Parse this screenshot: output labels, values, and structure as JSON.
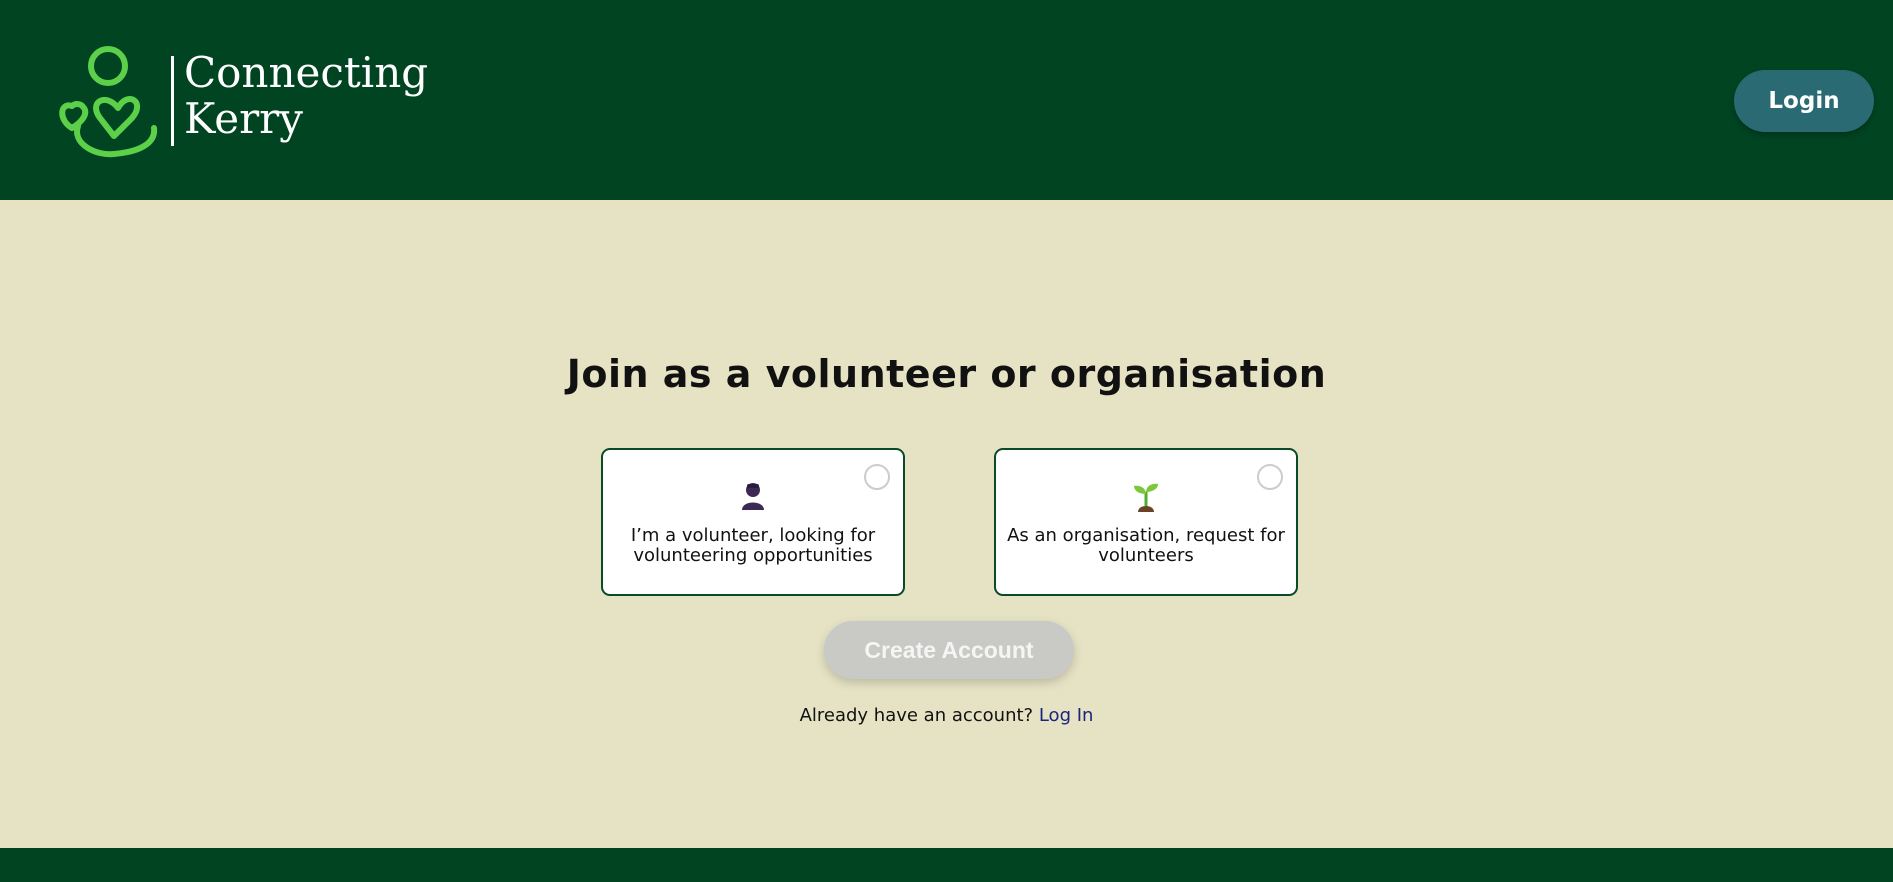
{
  "header": {
    "logo_line1": "Connecting",
    "logo_line2": "Kerry",
    "login_label": "Login"
  },
  "main": {
    "title": "Join as a volunteer or organisation",
    "options": [
      {
        "text": "I’m a volunteer, looking for volunteering opportunities",
        "icon": "person-icon",
        "selected": false
      },
      {
        "text": "As an organisation, request for volunteers",
        "icon": "seedling-icon",
        "selected": false
      }
    ],
    "create_account_label": "Create Account",
    "already_text": "Already have an account?",
    "login_link": "Log In"
  },
  "colors": {
    "header_bg": "#004422",
    "page_bg": "#e6e3c5",
    "logo_green": "#5dd04a",
    "login_btn": "#2a6b73",
    "disabled_btn": "#c9c9c6",
    "link": "#1a237e"
  }
}
